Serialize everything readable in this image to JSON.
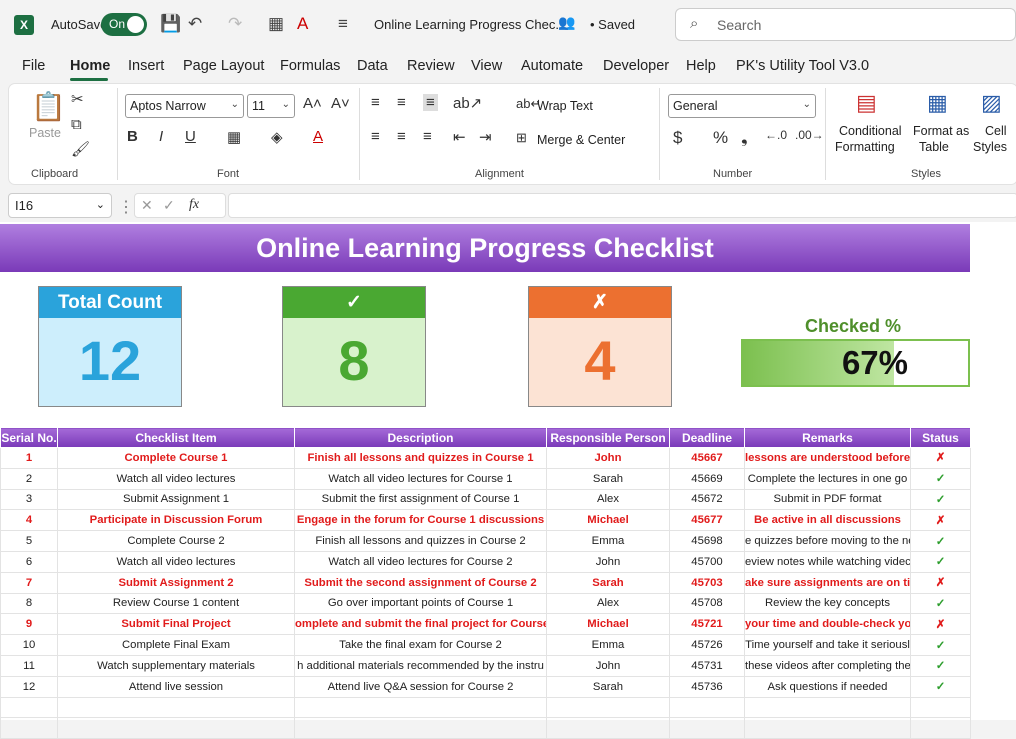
{
  "titlebar": {
    "autosave_label": "AutoSave",
    "autosave_state": "On",
    "doc_title": "Online Learning Progress Chec...",
    "saved": "• Saved",
    "search_placeholder": "Search"
  },
  "menu": [
    "File",
    "Home",
    "Insert",
    "Page Layout",
    "Formulas",
    "Data",
    "Review",
    "View",
    "Automate",
    "Developer",
    "Help",
    "PK's Utility Tool V3.0"
  ],
  "ribbon": {
    "clipboard": {
      "paste": "Paste",
      "group": "Clipboard"
    },
    "font": {
      "name": "Aptos Narrow",
      "size": "11",
      "group": "Font"
    },
    "alignment": {
      "wrap": "Wrap Text",
      "merge": "Merge & Center",
      "group": "Alignment"
    },
    "number": {
      "format": "General",
      "group": "Number"
    },
    "styles": {
      "cond1": "Conditional",
      "cond2": "Formatting",
      "fmt1": "Format as",
      "fmt2": "Table",
      "cell1": "Cell",
      "cell2": "Styles",
      "group": "Styles"
    }
  },
  "formula_bar": {
    "cell_ref": "I16",
    "fx": "fx",
    "content": ""
  },
  "sheet": {
    "title": "Online Learning Progress Checklist",
    "cards": {
      "total_label": "Total Count",
      "total_value": "12",
      "checked_label": "✓",
      "checked_value": "8",
      "unchecked_label": "✗",
      "unchecked_value": "4"
    },
    "checked_pct_label": "Checked %",
    "checked_pct_text": "67%",
    "checked_pct_fraction": 0.67,
    "colors": {
      "banner": "#7a3ab8",
      "blue": "#2aa3db",
      "green": "#4aa832",
      "orange": "#ec7030"
    },
    "columns": [
      "Serial No.",
      "Checklist Item",
      "Description",
      "Responsible Person",
      "Deadline",
      "Remarks",
      "Status"
    ],
    "rows": [
      {
        "sn": "1",
        "item": "Complete Course 1",
        "desc": "Finish all lessons and quizzes in Course 1",
        "person": "John",
        "deadline": "45667",
        "remarks": "lessons are understood before s",
        "status": "✗"
      },
      {
        "sn": "2",
        "item": "Watch all video lectures",
        "desc": "Watch all video lectures for Course 1",
        "person": "Sarah",
        "deadline": "45669",
        "remarks": "Complete the lectures in one go",
        "status": "✓"
      },
      {
        "sn": "3",
        "item": "Submit Assignment 1",
        "desc": "Submit the first assignment of Course 1",
        "person": "Alex",
        "deadline": "45672",
        "remarks": "Submit in PDF format",
        "status": "✓"
      },
      {
        "sn": "4",
        "item": "Participate in Discussion Forum",
        "desc": "Engage in the forum for Course 1 discussions",
        "person": "Michael",
        "deadline": "45677",
        "remarks": "Be active in all discussions",
        "status": "✗"
      },
      {
        "sn": "5",
        "item": "Complete Course 2",
        "desc": "Finish all lessons and quizzes in Course 2",
        "person": "Emma",
        "deadline": "45698",
        "remarks": "e quizzes before moving to the ne",
        "status": "✓"
      },
      {
        "sn": "6",
        "item": "Watch all video lectures",
        "desc": "Watch all video lectures for Course 2",
        "person": "John",
        "deadline": "45700",
        "remarks": "eview notes while watching videc",
        "status": "✓"
      },
      {
        "sn": "7",
        "item": "Submit Assignment 2",
        "desc": "Submit the second assignment of Course 2",
        "person": "Sarah",
        "deadline": "45703",
        "remarks": "ake sure assignments are on tim",
        "status": "✗"
      },
      {
        "sn": "8",
        "item": "Review Course 1 content",
        "desc": "Go over important points of Course 1",
        "person": "Alex",
        "deadline": "45708",
        "remarks": "Review the key concepts",
        "status": "✓"
      },
      {
        "sn": "9",
        "item": "Submit Final Project",
        "desc": "omplete and submit the final project for Course",
        "person": "Michael",
        "deadline": "45721",
        "remarks": "your time and double-check your",
        "status": "✗"
      },
      {
        "sn": "10",
        "item": "Complete Final Exam",
        "desc": "Take the final exam for Course 2",
        "person": "Emma",
        "deadline": "45726",
        "remarks": "Time yourself and take it seriousl",
        "status": "✓"
      },
      {
        "sn": "11",
        "item": "Watch supplementary materials",
        "desc": "h additional materials recommended by the instru",
        "person": "John",
        "deadline": "45731",
        "remarks": "these videos after completing the",
        "status": "✓"
      },
      {
        "sn": "12",
        "item": "Attend live session",
        "desc": "Attend live Q&A session for Course 2",
        "person": "Sarah",
        "deadline": "45736",
        "remarks": "Ask questions if needed",
        "status": "✓"
      }
    ]
  }
}
